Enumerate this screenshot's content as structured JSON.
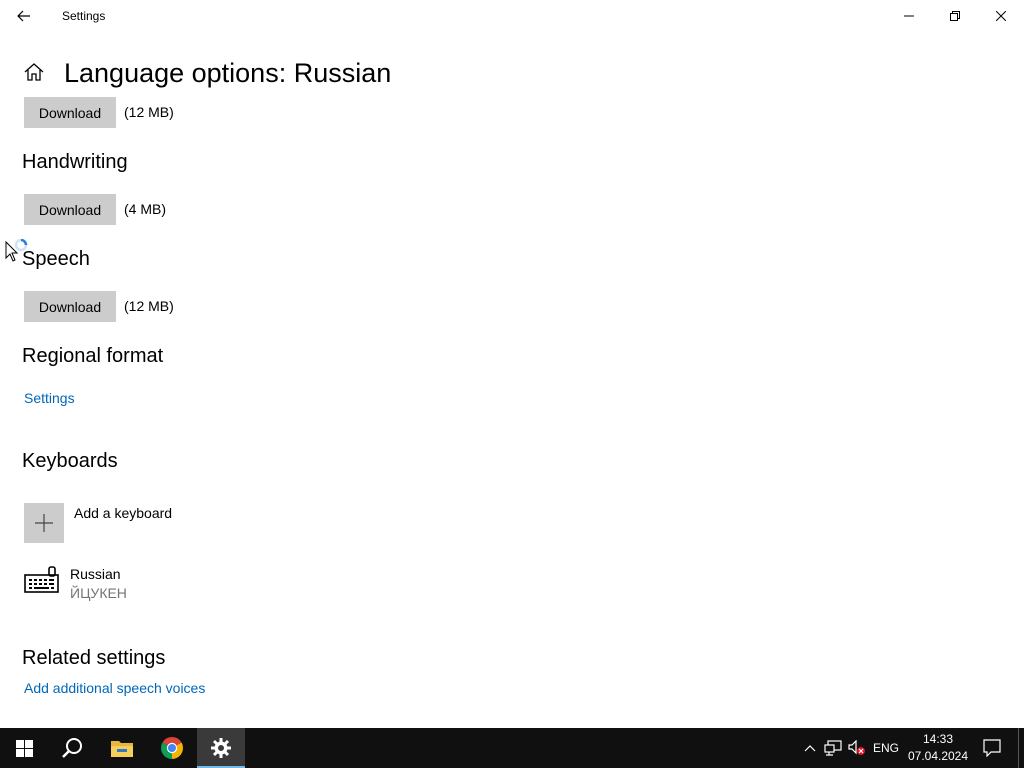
{
  "window": {
    "title": "Settings"
  },
  "page": {
    "title": "Language options: Russian"
  },
  "downloads": {
    "first": {
      "button": "Download",
      "size": "(12 MB)"
    },
    "handwriting": {
      "heading": "Handwriting",
      "button": "Download",
      "size": "(4 MB)"
    },
    "speech": {
      "heading": "Speech",
      "button": "Download",
      "size": "(12 MB)"
    }
  },
  "regional_format": {
    "heading": "Regional format",
    "link": "Settings"
  },
  "keyboards": {
    "heading": "Keyboards",
    "add_label": "Add a keyboard",
    "items": [
      {
        "name": "Russian",
        "layout": "ЙЦУКЕН"
      }
    ]
  },
  "related_settings": {
    "heading": "Related settings",
    "link": "Add additional speech voices"
  },
  "taskbar": {
    "pinned": [
      "start-icon",
      "search-icon",
      "file-explorer-icon",
      "chrome-icon",
      "settings-icon"
    ],
    "language": "ENG",
    "time": "14:33",
    "date": "07.04.2024"
  },
  "colors": {
    "link": "#0067b8",
    "button_bg": "#cccccc",
    "taskbar_bg": "#101010",
    "active_indicator": "#76b9ed"
  }
}
